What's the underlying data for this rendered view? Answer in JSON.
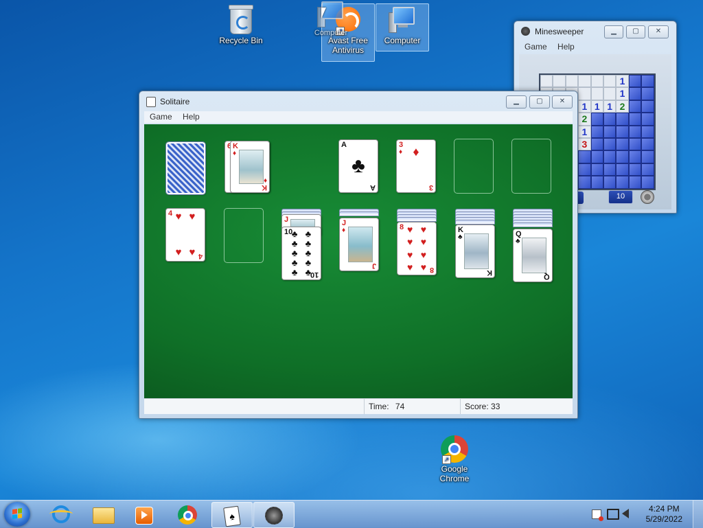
{
  "desktop": {
    "icons": {
      "recycle_bin": "Recycle Bin",
      "avast": "Avast Free Antivirus",
      "computer": "Computer",
      "computer_drag_ghost": "Computer",
      "chrome": "Google Chrome"
    }
  },
  "solitaire": {
    "title": "Solitaire",
    "menu": [
      "Game",
      "Help"
    ],
    "status": {
      "time_label": "Time:",
      "time_value": "74",
      "score_label": "Score:",
      "score_value": "33"
    },
    "waste_card": {
      "rank": "K",
      "suit": "♦",
      "underneath_rank": "6"
    },
    "foundations": [
      {
        "rank": "A",
        "suit": "♣",
        "color": "black"
      },
      {
        "rank": "3",
        "suit": "♦",
        "color": "red"
      }
    ],
    "tableau": [
      {
        "rank": "4",
        "suit": "♥"
      },
      {
        "rank": "",
        "suit": ""
      },
      {
        "rank": "10",
        "suit": "♣",
        "under_rank": "J"
      },
      {
        "rank": "J",
        "suit": "♦"
      },
      {
        "rank": "8",
        "suit": "♥"
      },
      {
        "rank": "K",
        "suit": "♣"
      },
      {
        "rank": "Q",
        "suit": "♣"
      }
    ]
  },
  "minesweeper": {
    "title": "Minesweeper",
    "menu": [
      "Game",
      "Help"
    ],
    "mine_counter": "10",
    "grid": [
      [
        "o",
        "o",
        "o",
        "o",
        "o",
        "o",
        "1",
        "c",
        "c"
      ],
      [
        "o",
        "o",
        "o",
        "o",
        "o",
        "o",
        "1",
        "c",
        "c"
      ],
      [
        "c",
        "c",
        "c",
        "1",
        "1",
        "1",
        "2",
        "c",
        "c"
      ],
      [
        "c",
        "c",
        "c",
        "2",
        "c",
        "c",
        "c",
        "c",
        "c"
      ],
      [
        "c",
        "c",
        "c",
        "1",
        "c",
        "c",
        "c",
        "c",
        "c"
      ],
      [
        "c",
        "c",
        "c",
        "3",
        "c",
        "c",
        "c",
        "c",
        "c"
      ],
      [
        "c",
        "c",
        "c",
        "c",
        "c",
        "c",
        "c",
        "c",
        "c"
      ],
      [
        "c",
        "c",
        "c",
        "c",
        "c",
        "c",
        "c",
        "c",
        "c"
      ],
      [
        "c",
        "c",
        "c",
        "c",
        "c",
        "c",
        "c",
        "c",
        "c"
      ]
    ]
  },
  "taskbar": {
    "pinned": [
      "internet-explorer",
      "windows-explorer",
      "media-player",
      "google-chrome",
      "solitaire",
      "minesweeper"
    ],
    "time": "4:24 PM",
    "date": "5/29/2022"
  },
  "colors": {
    "felt": "#128032",
    "window_frame": "#c5d8ec",
    "taskbar": "#8fb1dc",
    "desktop": "#1474c9"
  }
}
